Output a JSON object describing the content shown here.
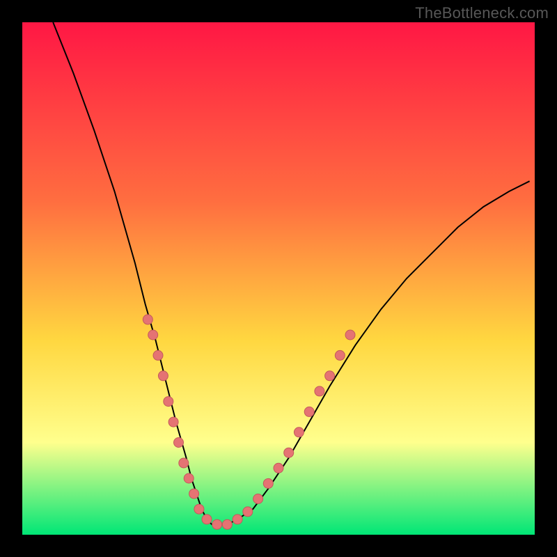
{
  "watermark": "TheBottleneck.com",
  "colors": {
    "gradient_top": "#ff1744",
    "gradient_mid1": "#ff6e40",
    "gradient_mid2": "#ffd740",
    "gradient_mid3": "#ffff8d",
    "gradient_bottom": "#00e676",
    "curve": "#000000",
    "dot_fill": "#e57373",
    "dot_stroke": "#c25b5b"
  },
  "chart_data": {
    "type": "line",
    "title": "",
    "xlabel": "",
    "ylabel": "",
    "xlim": [
      0,
      100
    ],
    "ylim": [
      0,
      100
    ],
    "curve": {
      "x": [
        6,
        10,
        14,
        18,
        22,
        24,
        26,
        28,
        30,
        32,
        33,
        34,
        35,
        36,
        37,
        38,
        40,
        42,
        45,
        48,
        52,
        56,
        60,
        65,
        70,
        75,
        80,
        85,
        90,
        95,
        99
      ],
      "y": [
        100,
        90,
        79,
        67,
        53,
        45,
        38,
        30,
        22,
        15,
        11,
        8,
        5,
        3,
        2,
        2,
        2,
        3,
        5,
        9,
        15,
        22,
        29,
        37,
        44,
        50,
        55,
        60,
        64,
        67,
        69
      ]
    },
    "dots": [
      {
        "x": 24.5,
        "y": 42
      },
      {
        "x": 25.5,
        "y": 39
      },
      {
        "x": 26.5,
        "y": 35
      },
      {
        "x": 27.5,
        "y": 31
      },
      {
        "x": 28.5,
        "y": 26
      },
      {
        "x": 29.5,
        "y": 22
      },
      {
        "x": 30.5,
        "y": 18
      },
      {
        "x": 31.5,
        "y": 14
      },
      {
        "x": 32.5,
        "y": 11
      },
      {
        "x": 33.5,
        "y": 8
      },
      {
        "x": 34.5,
        "y": 5
      },
      {
        "x": 36.0,
        "y": 3
      },
      {
        "x": 38.0,
        "y": 2
      },
      {
        "x": 40.0,
        "y": 2
      },
      {
        "x": 42.0,
        "y": 3
      },
      {
        "x": 44.0,
        "y": 4.5
      },
      {
        "x": 46.0,
        "y": 7
      },
      {
        "x": 48.0,
        "y": 10
      },
      {
        "x": 50.0,
        "y": 13
      },
      {
        "x": 52.0,
        "y": 16
      },
      {
        "x": 54.0,
        "y": 20
      },
      {
        "x": 56.0,
        "y": 24
      },
      {
        "x": 58.0,
        "y": 28
      },
      {
        "x": 60.0,
        "y": 31
      },
      {
        "x": 62.0,
        "y": 35
      },
      {
        "x": 64.0,
        "y": 39
      }
    ]
  }
}
